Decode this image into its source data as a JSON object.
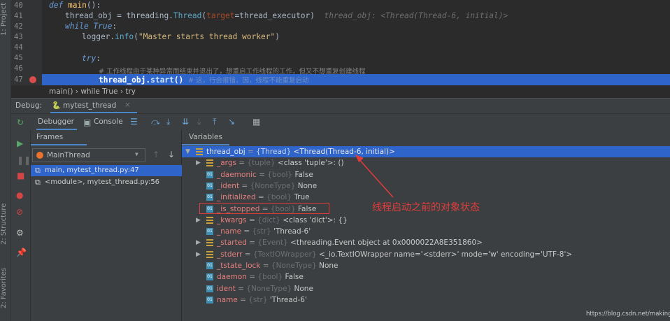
{
  "sidebar_tabs": [
    "1: Project",
    "2: Structure",
    "2: Favorites"
  ],
  "editor": {
    "lines": [
      {
        "n": "40"
      },
      {
        "n": "41"
      },
      {
        "n": "42"
      },
      {
        "n": "43"
      },
      {
        "n": "44"
      },
      {
        "n": "45"
      },
      {
        "n": "46"
      },
      {
        "n": "47"
      }
    ],
    "code": {
      "l40_kw": "def ",
      "l40_fn": "main",
      "l40_rest": "():",
      "l41_a": "thread_obj = threading.",
      "l41_cls": "Thread",
      "l41_p": "(",
      "l41_prm": "target",
      "l41_b": "=thread_executor)",
      "l41_hint": "thread_obj: <Thread(Thread-6, initial)>",
      "l42_kw": "while True",
      ":": ":",
      "l43_a": "logger.",
      "l43_fn": "info",
      "l43_p": "(",
      "l43_str": "\"Master starts thread worker\"",
      "l43_e": ")",
      "l45_kw": "try",
      "l46_cm": "# 工作线程由于某种异常而结束并退出了，想重启工作线程的工作，但又不想重复创建线程",
      "l47_a": "thread_obj.",
      "l47_fn": "start",
      "l47_b": "()",
      "l47_cm": "# 这，行会报错，因，线程不能重复启动"
    },
    "breadcrumb": [
      "main()",
      "while True",
      "try"
    ]
  },
  "debug": {
    "label": "Debug:",
    "tab": "mytest_thread",
    "tab_close": "×"
  },
  "toolbar": {
    "debugger": "Debugger",
    "console": "Console"
  },
  "frames": {
    "title": "Frames",
    "thread": "MainThread",
    "items": [
      "main, mytest_thread.py:47",
      "<module>, mytest_thread.py:56"
    ]
  },
  "variables": {
    "title": "Variables",
    "rows": [
      {
        "name": "thread_obj",
        "type": "{Thread}",
        "value": "<Thread(Thread-6, initial)>",
        "expandable": true,
        "expanded": true,
        "icon": "list"
      },
      {
        "name": "_args",
        "type": "{tuple}",
        "value": "<class 'tuple'>: ()",
        "expandable": true,
        "icon": "list"
      },
      {
        "name": "_daemonic",
        "type": "{bool}",
        "value": "False",
        "icon": "bool"
      },
      {
        "name": "_ident",
        "type": "{NoneType}",
        "value": "None",
        "icon": "bool"
      },
      {
        "name": "_initialized",
        "type": "{bool}",
        "value": "True",
        "icon": "bool"
      },
      {
        "name": "_is_stopped",
        "type": "{bool}",
        "value": "False",
        "icon": "bool"
      },
      {
        "name": "_kwargs",
        "type": "{dict}",
        "value": "<class 'dict'>: {}",
        "expandable": true,
        "icon": "list"
      },
      {
        "name": "_name",
        "type": "{str}",
        "value": "'Thread-6'",
        "icon": "bool"
      },
      {
        "name": "_started",
        "type": "{Event}",
        "value": "<threading.Event object at 0x0000022A8E351860>",
        "expandable": true,
        "icon": "list"
      },
      {
        "name": "_stderr",
        "type": "{TextIOWrapper}",
        "value": "<_io.TextIOWrapper name='<stderr>' mode='w' encoding='UTF-8'>",
        "expandable": true,
        "icon": "list"
      },
      {
        "name": "_tstate_lock",
        "type": "{NoneType}",
        "value": "None",
        "icon": "bool"
      },
      {
        "name": "daemon",
        "type": "{bool}",
        "value": "False",
        "icon": "bool"
      },
      {
        "name": "ident",
        "type": "{NoneType}",
        "value": "None",
        "icon": "bool"
      },
      {
        "name": "name",
        "type": "{str}",
        "value": "'Thread-6'",
        "icon": "bool"
      }
    ]
  },
  "annotation": {
    "text": "线程启动之前的对象状态",
    "color": "#e03c3c"
  },
  "watermark": "https://blog.csdn.net/makingLJ"
}
